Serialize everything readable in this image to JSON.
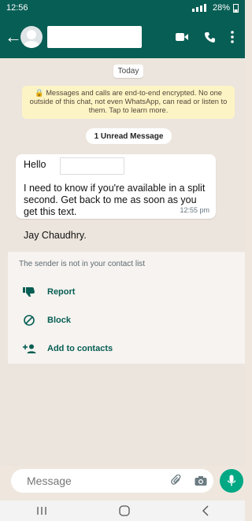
{
  "status": {
    "time": "12:56",
    "battery": "28%"
  },
  "header": {
    "back_label": "←"
  },
  "chat": {
    "date_chip": "Today",
    "encryption_notice": "🔒 Messages and calls are end-to-end encrypted. No one outside of this chat, not even WhatsApp, can read or listen to them. Tap to learn more.",
    "unread_label": "1 Unread Message",
    "message": {
      "text": "Hello\n\nI need to know if you're available in a split second. Get back to me as soon as you get this text.\n\nJay Chaudhry.",
      "time": "12:55 pm"
    }
  },
  "unknown_contact": {
    "note": "The sender is not in your contact list",
    "actions": [
      "Report",
      "Block",
      "Add to contacts"
    ]
  },
  "composer": {
    "placeholder": "Message"
  },
  "colors": {
    "primary": "#075e54",
    "accent": "#00a884",
    "chat_bg": "#ece5dd"
  }
}
